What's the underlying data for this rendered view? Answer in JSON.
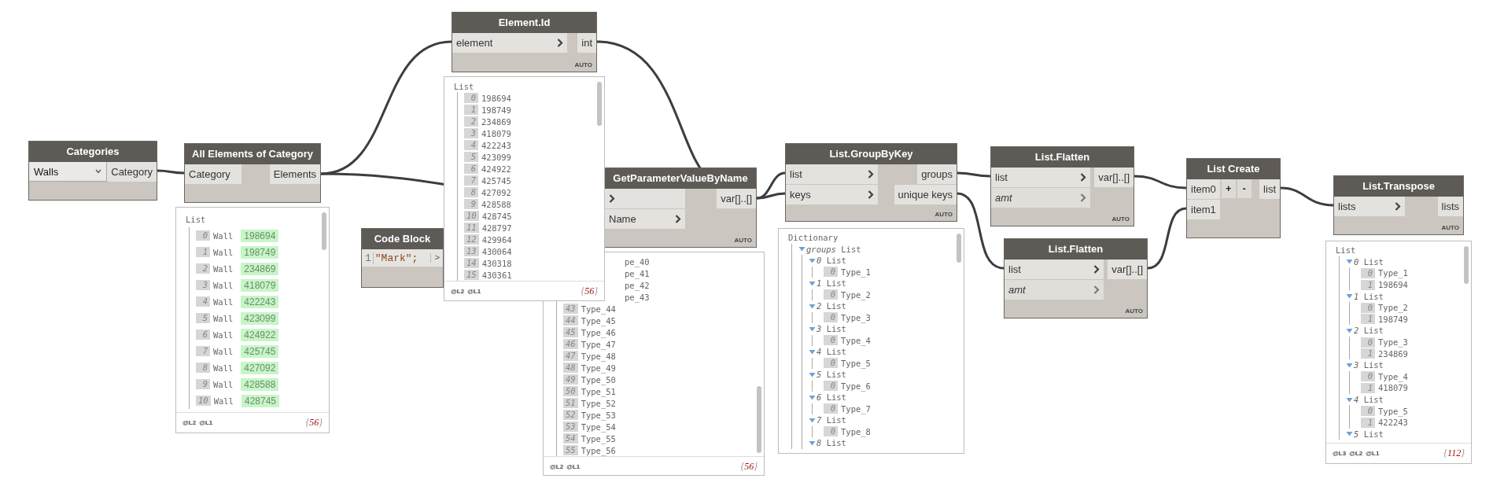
{
  "nodes": [
    {
      "kind": "dropdown",
      "title": "Categories",
      "value": "Walls",
      "outputs": [
        "Category"
      ]
    },
    {
      "kind": "builtin",
      "title": "All Elements of Category",
      "inputs": [
        {
          "label": "Category"
        }
      ],
      "outputs": [
        "Elements"
      ]
    },
    {
      "kind": "function",
      "title": "Element.Id",
      "inputs": [
        {
          "label": "element",
          "optional": false
        }
      ],
      "outputs": [
        "int"
      ],
      "lacing": "AUTO"
    },
    {
      "kind": "code_block",
      "title": "Code Block",
      "lines": [
        {
          "number": "1",
          "code": "\"Mark\";"
        }
      ],
      "outputs": [
        ">"
      ]
    },
    {
      "kind": "function",
      "title": "GetParameterValueByName",
      "inputs": [
        {
          "optional": false
        },
        {
          "label": "Name",
          "optional": false
        }
      ],
      "outputs": [
        "var[]..[]"
      ],
      "lacing": "AUTO"
    },
    {
      "kind": "function",
      "title": "List.GroupByKey",
      "inputs": [
        {
          "label": "list",
          "optional": false
        },
        {
          "label": "keys",
          "optional": false
        }
      ],
      "outputs": [
        "groups",
        "unique keys"
      ],
      "lacing": "AUTO"
    },
    {
      "kind": "function",
      "title": "List.Flatten",
      "inputs": [
        {
          "label": "list",
          "optional": false
        },
        {
          "label": "amt",
          "optional": true
        }
      ],
      "outputs": [
        "var[]..[]"
      ],
      "lacing": "AUTO"
    },
    {
      "kind": "function",
      "title": "List.Flatten",
      "inputs": [
        {
          "label": "list",
          "optional": false
        },
        {
          "label": "amt",
          "optional": true
        }
      ],
      "outputs": [
        "var[]..[]"
      ],
      "lacing": "AUTO"
    },
    {
      "kind": "list_create",
      "title": "List Create",
      "inputs": [
        {
          "label": "item0"
        },
        {
          "label": "item1"
        }
      ],
      "buttons": [
        "+",
        "-"
      ],
      "outputs": [
        "list"
      ]
    },
    {
      "kind": "function",
      "title": "List.Transpose",
      "inputs": [
        {
          "label": "lists",
          "optional": false
        }
      ],
      "outputs": [
        "lists"
      ],
      "lacing": "AUTO"
    }
  ],
  "previews": [
    {
      "kind": "element_list",
      "header": "List",
      "items": [
        {
          "index": "0",
          "type": "Wall",
          "value": "198694"
        },
        {
          "index": "1",
          "type": "Wall",
          "value": "198749"
        },
        {
          "index": "2",
          "type": "Wall",
          "value": "234869"
        },
        {
          "index": "3",
          "type": "Wall",
          "value": "418079"
        },
        {
          "index": "4",
          "type": "Wall",
          "value": "422243"
        },
        {
          "index": "5",
          "type": "Wall",
          "value": "423099"
        },
        {
          "index": "6",
          "type": "Wall",
          "value": "424922"
        },
        {
          "index": "7",
          "type": "Wall",
          "value": "425745"
        },
        {
          "index": "8",
          "type": "Wall",
          "value": "427092"
        },
        {
          "index": "9",
          "type": "Wall",
          "value": "428588"
        },
        {
          "index": "10",
          "type": "Wall",
          "value": "428745"
        }
      ],
      "levels": [
        "@L2",
        "@L1"
      ],
      "count": "{56}"
    },
    {
      "kind": "list",
      "header": "List",
      "items": [
        {
          "index": "0",
          "value": "198694"
        },
        {
          "index": "1",
          "value": "198749"
        },
        {
          "index": "2",
          "value": "234869"
        },
        {
          "index": "3",
          "value": "418079"
        },
        {
          "index": "4",
          "value": "422243"
        },
        {
          "index": "5",
          "value": "423099"
        },
        {
          "index": "6",
          "value": "424922"
        },
        {
          "index": "7",
          "value": "425745"
        },
        {
          "index": "8",
          "value": "427092"
        },
        {
          "index": "9",
          "value": "428588"
        },
        {
          "index": "10",
          "value": "428745"
        },
        {
          "index": "11",
          "value": "428797"
        },
        {
          "index": "12",
          "value": "429964"
        },
        {
          "index": "13",
          "value": "430064"
        },
        {
          "index": "14",
          "value": "430318"
        },
        {
          "index": "15",
          "value": "430361"
        }
      ],
      "levels": [
        "@L2",
        "@L1"
      ],
      "count": "{56}"
    },
    {
      "kind": "list",
      "items": [
        {
          "value": "pe_40"
        },
        {
          "value": "pe_41"
        },
        {
          "value": "pe_42"
        },
        {
          "value": "pe_43"
        },
        {
          "index": "43",
          "value": "Type_44"
        },
        {
          "index": "44",
          "value": "Type_45"
        },
        {
          "index": "45",
          "value": "Type_46"
        },
        {
          "index": "46",
          "value": "Type_47"
        },
        {
          "index": "47",
          "value": "Type_48"
        },
        {
          "index": "48",
          "value": "Type_49"
        },
        {
          "index": "49",
          "value": "Type_50"
        },
        {
          "index": "50",
          "value": "Type_51"
        },
        {
          "index": "51",
          "value": "Type_52"
        },
        {
          "index": "52",
          "value": "Type_53"
        },
        {
          "index": "53",
          "value": "Type_54"
        },
        {
          "index": "54",
          "value": "Type_55"
        },
        {
          "index": "55",
          "value": "Type_56"
        }
      ],
      "levels": [
        "@L2",
        "@L1"
      ],
      "count": "{56}"
    },
    {
      "kind": "tree",
      "header": "Dictionary",
      "children": [
        {
          "key": "groups",
          "label": "List",
          "expanded": true,
          "children": [
            {
              "key": "0",
              "label": "List",
              "expanded": true,
              "children": [
                {
                  "index": "0",
                  "value": "Type_1"
                }
              ]
            },
            {
              "key": "1",
              "label": "List",
              "expanded": true,
              "children": [
                {
                  "index": "0",
                  "value": "Type_2"
                }
              ]
            },
            {
              "key": "2",
              "label": "List",
              "expanded": true,
              "children": [
                {
                  "index": "0",
                  "value": "Type_3"
                }
              ]
            },
            {
              "key": "3",
              "label": "List",
              "expanded": true,
              "children": [
                {
                  "index": "0",
                  "value": "Type_4"
                }
              ]
            },
            {
              "key": "4",
              "label": "List",
              "expanded": true,
              "children": [
                {
                  "index": "0",
                  "value": "Type_5"
                }
              ]
            },
            {
              "key": "5",
              "label": "List",
              "expanded": true,
              "children": [
                {
                  "index": "0",
                  "value": "Type_6"
                }
              ]
            },
            {
              "key": "6",
              "label": "List",
              "expanded": true,
              "children": [
                {
                  "index": "0",
                  "value": "Type_7"
                }
              ]
            },
            {
              "key": "7",
              "label": "List",
              "expanded": true,
              "children": [
                {
                  "index": "0",
                  "value": "Type_8"
                }
              ]
            },
            {
              "key": "8",
              "label": "List",
              "expanded": true
            }
          ]
        }
      ]
    },
    {
      "kind": "tree",
      "header": "List",
      "children": [
        {
          "key": "0",
          "label": "List",
          "expanded": true,
          "children": [
            {
              "index": "0",
              "value": "Type_1"
            },
            {
              "index": "1",
              "value": "198694"
            }
          ]
        },
        {
          "key": "1",
          "label": "List",
          "expanded": true,
          "children": [
            {
              "index": "0",
              "value": "Type_2"
            },
            {
              "index": "1",
              "value": "198749"
            }
          ]
        },
        {
          "key": "2",
          "label": "List",
          "expanded": true,
          "children": [
            {
              "index": "0",
              "value": "Type_3"
            },
            {
              "index": "1",
              "value": "234869"
            }
          ]
        },
        {
          "key": "3",
          "label": "List",
          "expanded": true,
          "children": [
            {
              "index": "0",
              "value": "Type_4"
            },
            {
              "index": "1",
              "value": "418079"
            }
          ]
        },
        {
          "key": "4",
          "label": "List",
          "expanded": true,
          "children": [
            {
              "index": "0",
              "value": "Type_5"
            },
            {
              "index": "1",
              "value": "422243"
            }
          ]
        },
        {
          "key": "5",
          "label": "List",
          "expanded": true
        }
      ],
      "levels": [
        "@L3",
        "@L2",
        "@L1"
      ],
      "count": "{112}"
    }
  ]
}
